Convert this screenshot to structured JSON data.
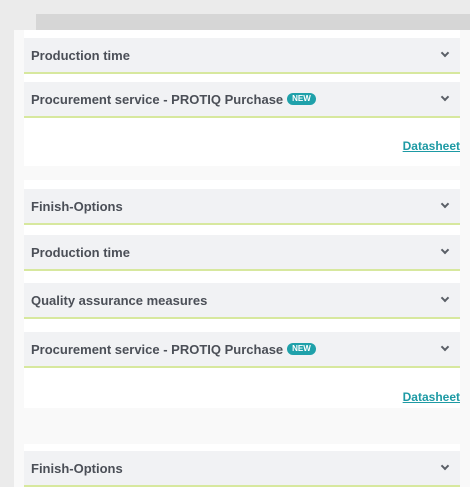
{
  "cards": [
    {
      "rows": [
        {
          "label": "Production time"
        },
        {
          "label": "Procurement service - PROTIQ Purchase",
          "badge": "NEW"
        }
      ],
      "datasheet_link": "Datasheet"
    },
    {
      "rows": [
        {
          "label": "Finish-Options"
        },
        {
          "label": "Production time"
        },
        {
          "label": "Quality assurance measures"
        },
        {
          "label": "Procurement service - PROTIQ Purchase",
          "badge": "NEW"
        }
      ],
      "datasheet_link": "Datasheet"
    },
    {
      "rows": [
        {
          "label": "Finish-Options"
        }
      ]
    }
  ],
  "colors": {
    "accent": "#1d9aa4",
    "row_divider": "#d7e89e",
    "badge_bg": "#1fa1aa"
  },
  "icons": {
    "row_toggle": "chevron-down-icon"
  }
}
